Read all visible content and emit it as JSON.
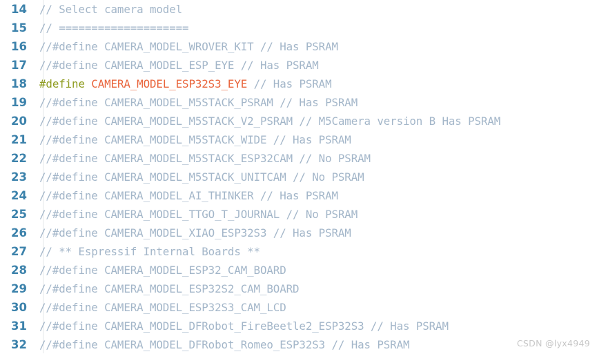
{
  "editor": {
    "language": "c",
    "first_line_number": 14,
    "colors": {
      "background": "#ffffff",
      "line_number": "#3c82ab",
      "gutter_rule": "#e3e6e8",
      "comment": "#a3b6c9",
      "preprocessor": "#8f9c20",
      "macro_name": "#e9643b",
      "watermark": "#c7c7c7"
    },
    "lines": [
      {
        "number": "14",
        "tokens": [
          {
            "type": "comment",
            "text": "// Select camera model"
          }
        ]
      },
      {
        "number": "15",
        "tokens": [
          {
            "type": "comment",
            "text": "// ===================="
          }
        ]
      },
      {
        "number": "16",
        "tokens": [
          {
            "type": "comment",
            "text": "//#define CAMERA_MODEL_WROVER_KIT // Has PSRAM"
          }
        ]
      },
      {
        "number": "17",
        "tokens": [
          {
            "type": "comment",
            "text": "//#define CAMERA_MODEL_ESP_EYE // Has PSRAM"
          }
        ]
      },
      {
        "number": "18",
        "tokens": [
          {
            "type": "preproc",
            "text": "#define"
          },
          {
            "type": "plain",
            "text": " "
          },
          {
            "type": "macro",
            "text": "CAMERA_MODEL_ESP32S3_EYE"
          },
          {
            "type": "plain",
            "text": " "
          },
          {
            "type": "comment",
            "text": "// Has PSRAM"
          }
        ]
      },
      {
        "number": "19",
        "tokens": [
          {
            "type": "comment",
            "text": "//#define CAMERA_MODEL_M5STACK_PSRAM // Has PSRAM"
          }
        ]
      },
      {
        "number": "20",
        "tokens": [
          {
            "type": "comment",
            "text": "//#define CAMERA_MODEL_M5STACK_V2_PSRAM // M5Camera version B Has PSRAM"
          }
        ]
      },
      {
        "number": "21",
        "tokens": [
          {
            "type": "comment",
            "text": "//#define CAMERA_MODEL_M5STACK_WIDE // Has PSRAM"
          }
        ]
      },
      {
        "number": "22",
        "tokens": [
          {
            "type": "comment",
            "text": "//#define CAMERA_MODEL_M5STACK_ESP32CAM // No PSRAM"
          }
        ]
      },
      {
        "number": "23",
        "tokens": [
          {
            "type": "comment",
            "text": "//#define CAMERA_MODEL_M5STACK_UNITCAM // No PSRAM"
          }
        ]
      },
      {
        "number": "24",
        "tokens": [
          {
            "type": "comment",
            "text": "//#define CAMERA_MODEL_AI_THINKER // Has PSRAM"
          }
        ]
      },
      {
        "number": "25",
        "tokens": [
          {
            "type": "comment",
            "text": "//#define CAMERA_MODEL_TTGO_T_JOURNAL // No PSRAM"
          }
        ]
      },
      {
        "number": "26",
        "tokens": [
          {
            "type": "comment",
            "text": "//#define CAMERA_MODEL_XIAO_ESP32S3 // Has PSRAM"
          }
        ]
      },
      {
        "number": "27",
        "tokens": [
          {
            "type": "comment",
            "text": "// ** Espressif Internal Boards **"
          }
        ]
      },
      {
        "number": "28",
        "tokens": [
          {
            "type": "comment",
            "text": "//#define CAMERA_MODEL_ESP32_CAM_BOARD"
          }
        ]
      },
      {
        "number": "29",
        "tokens": [
          {
            "type": "comment",
            "text": "//#define CAMERA_MODEL_ESP32S2_CAM_BOARD"
          }
        ]
      },
      {
        "number": "30",
        "tokens": [
          {
            "type": "comment",
            "text": "//#define CAMERA_MODEL_ESP32S3_CAM_LCD"
          }
        ]
      },
      {
        "number": "31",
        "tokens": [
          {
            "type": "comment",
            "text": "//#define CAMERA_MODEL_DFRobot_FireBeetle2_ESP32S3 // Has PSRAM"
          }
        ]
      },
      {
        "number": "32",
        "tokens": [
          {
            "type": "comment",
            "text": "//#define CAMERA_MODEL_DFRobot_Romeo_ESP32S3 // Has PSRAM"
          }
        ]
      }
    ]
  },
  "watermark": {
    "text": "CSDN @lyx4949"
  }
}
